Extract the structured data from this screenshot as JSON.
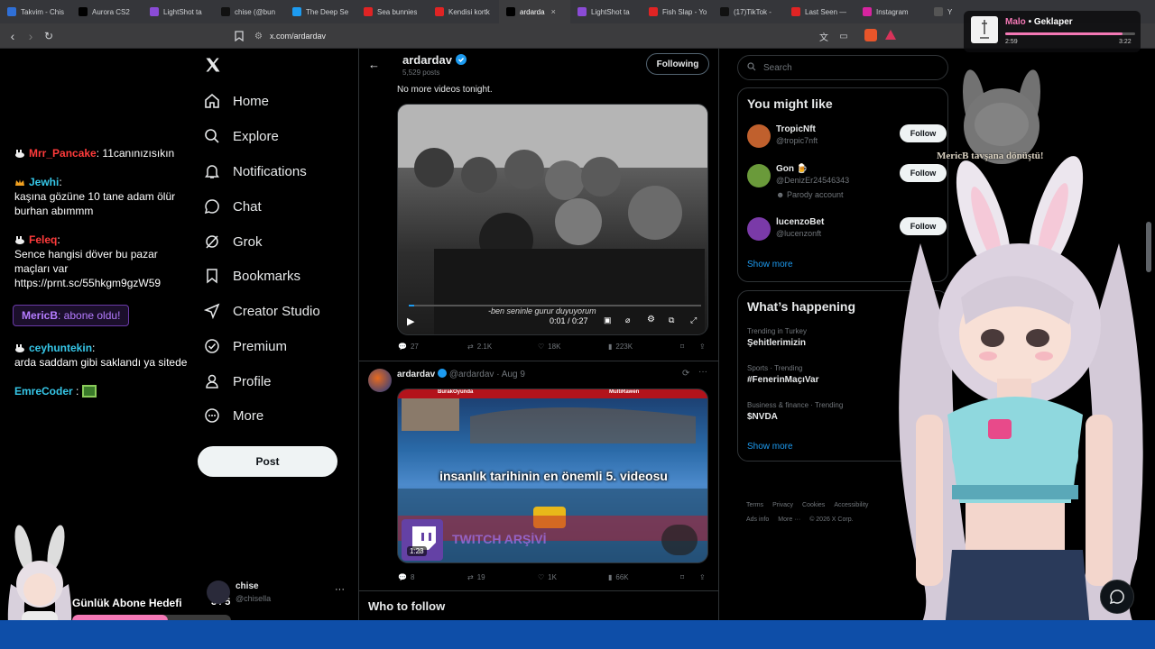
{
  "browser": {
    "tabs": [
      {
        "label": "Takvim - Chis",
        "color": "#2f6fd6"
      },
      {
        "label": "Aurora CS2",
        "color": "#000000"
      },
      {
        "label": "LightShot ta",
        "color": "#8a4bd6"
      },
      {
        "label": "chise (@bun",
        "color": "#111111"
      },
      {
        "label": "The Deep Se",
        "color": "#1d9bf0"
      },
      {
        "label": "Sea bunnies",
        "color": "#e02424"
      },
      {
        "label": "Kendisi kortk",
        "color": "#e02424"
      },
      {
        "label": "ardarda",
        "color": "#000000",
        "active": true
      },
      {
        "label": "LightShot ta",
        "color": "#8a4bd6"
      },
      {
        "label": "Fish Slap - Yo",
        "color": "#e02424"
      },
      {
        "label": "(17)TikTok -",
        "color": "#111111"
      },
      {
        "label": "Last Seen —",
        "color": "#e02424"
      },
      {
        "label": "Instagram",
        "color": "#d6249f"
      },
      {
        "label": "Y",
        "color": "#555555"
      }
    ],
    "url": "x.com/ardardav"
  },
  "stream": {
    "chat": [
      {
        "user": "Mrr_Pancake",
        "sep": ":",
        "text": "11canınızısıkın",
        "color": "#ff3b3b",
        "icon": "bunny-badge-icon"
      },
      {
        "user": "Jewhi",
        "sep": ":",
        "text": "kaşına gözüne 10 tane adam ölür burhan abımmm",
        "color": "#36c7e8",
        "icon": "crown-icon"
      },
      {
        "user": "Feleq",
        "sep": ":",
        "text": "Sence hangisi döver bu pazar maçları var https://prnt.sc/55hkgm9gzW59",
        "color": "#ff3b3b",
        "icon": "bunny-badge-icon"
      },
      {
        "user": "ceyhuntekin",
        "sep": ":",
        "text": "arda saddam gibi saklandı ya sitede",
        "color": "#36c7e8",
        "icon": "bunny-badge-icon"
      },
      {
        "user": "EmreCoder",
        "sep": ":",
        "text": "",
        "color": "#36c7e8",
        "icon": ""
      }
    ],
    "sub_alert": {
      "user": "MericB",
      "text": ": abone oldu!"
    },
    "goal": {
      "title": "Günlük Abone Hedefi",
      "count": "3 / 5",
      "progress": 0.6
    },
    "caption": "MericB tavşana dönüştü!"
  },
  "x": {
    "nav": [
      {
        "label": "Home",
        "icon": "home-icon"
      },
      {
        "label": "Explore",
        "icon": "search-icon"
      },
      {
        "label": "Notifications",
        "icon": "bell-icon"
      },
      {
        "label": "Chat",
        "icon": "chat-icon"
      },
      {
        "label": "Grok",
        "icon": "grok-icon"
      },
      {
        "label": "Bookmarks",
        "icon": "bookmark-icon"
      },
      {
        "label": "Creator Studio",
        "icon": "rocket-icon"
      },
      {
        "label": "Premium",
        "icon": "verified-icon"
      },
      {
        "label": "Profile",
        "icon": "person-icon"
      },
      {
        "label": "More",
        "icon": "more-icon"
      }
    ],
    "post_button": "Post",
    "account": {
      "name": "chise",
      "handle": "@chisella"
    },
    "profile_header": {
      "name": "ardardav",
      "posts": "5,529 posts",
      "following_label": "Following"
    },
    "post1": {
      "text": "No more videos tonight.",
      "subtitle": "-ben seninle gurur duyuyorum",
      "time": "0:01 / 0:27",
      "replies": "27",
      "reposts": "2.1K",
      "likes": "18K",
      "views": "223K"
    },
    "post2": {
      "name": "ardardav",
      "handle": "@ardardav",
      "date": "· Aug 9",
      "video_title": "insanlık tarihinin en önemli 5. videosu",
      "label_left": "BurakOyunda",
      "label_right": "MultiRawen",
      "watermark": "TWITCH ARŞİVİ",
      "duration": "1:23",
      "replies": "8",
      "reposts": "19",
      "likes": "1K",
      "views": "66K"
    },
    "who_to_follow_title": "Who to follow",
    "search_placeholder": "Search",
    "you_might_like": {
      "title": "You might like",
      "users": [
        {
          "name": "TropicNft",
          "handle": "@tropic7nft",
          "note": "",
          "color": "#c0602d"
        },
        {
          "name": "Gon 🍺",
          "handle": "@DenizEr24546343",
          "note": "Parody account",
          "color": "#6a9a3a"
        },
        {
          "name": "lucenzoBet",
          "handle": "@lucenzonft",
          "note": "",
          "color": "#7a3aa8"
        }
      ],
      "follow_label": "Follow",
      "show_more": "Show more"
    },
    "whats_happening": {
      "title": "What’s happening",
      "trends": [
        {
          "meta": "Trending in Turkey",
          "title": "Şehitlerimizin"
        },
        {
          "meta": "Sports · Trending",
          "title": "#FenerinMaçıVar"
        },
        {
          "meta": "Business & finance · Trending",
          "title": "$NVDA"
        }
      ],
      "show_more": "Show more"
    },
    "footer": [
      "Terms",
      "Privacy",
      "Cookies",
      "Accessibility",
      "Ads info",
      "More ···",
      "© 2026 X Corp."
    ]
  },
  "music": {
    "artist": "Malo",
    "title": "• Geklaper",
    "elapsed": "2:59",
    "duration": "3:22",
    "progress": 0.9
  }
}
